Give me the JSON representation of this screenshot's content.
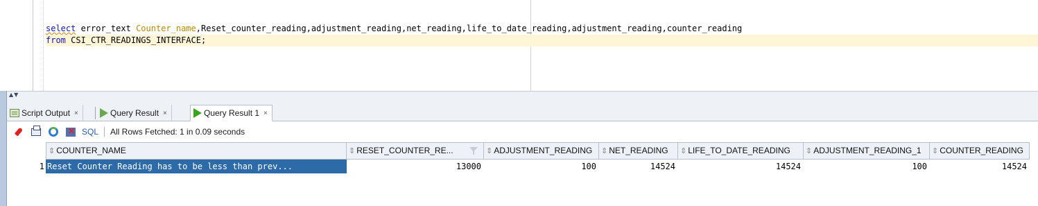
{
  "editor": {
    "line1": {
      "kw_select": "select",
      "part_a": " error_text ",
      "ident": "Counter_name",
      "part_b": ",Reset_counter_reading,adjustment_reading,net_reading,life_to_date_reading,adjustment_reading,counter_reading"
    },
    "line2": {
      "kw_from": "from",
      "rest": " CSI_CTR_READINGS_INTERFACE;"
    }
  },
  "splitter": {
    "arrows": "▲▼"
  },
  "tabs": [
    {
      "label": "Script Output",
      "close": "×",
      "icon": "script-output-icon"
    },
    {
      "label": "Query Result",
      "close": "×",
      "icon": "play-icon"
    },
    {
      "label": "Query Result 1",
      "close": "×",
      "icon": "play-icon",
      "active": true
    }
  ],
  "toolbar": {
    "icons": [
      "pin-icon",
      "print-icon",
      "refresh-icon",
      "cancel-icon"
    ],
    "sql_label": "SQL",
    "separator": "|",
    "status": "All Rows Fetched: 1 in 0.09 seconds"
  },
  "grid": {
    "sort_glyph": "⇕",
    "columns": [
      "COUNTER_NAME",
      "RESET_COUNTER_RE...",
      "ADJUSTMENT_READING",
      "NET_READING",
      "LIFE_TO_DATE_READING",
      "ADJUSTMENT_READING_1",
      "COUNTER_READING"
    ],
    "rows": [
      {
        "num": "1",
        "cells": [
          "Reset Counter Reading has to be less than prev...",
          "13000",
          "100",
          "14524",
          "14524",
          "100",
          "14524"
        ]
      }
    ]
  },
  "colors": {
    "keyword": "#1414b4",
    "identifier": "#b88a00",
    "selection": "#2d6aa8",
    "current_line": "#fff6d8"
  }
}
